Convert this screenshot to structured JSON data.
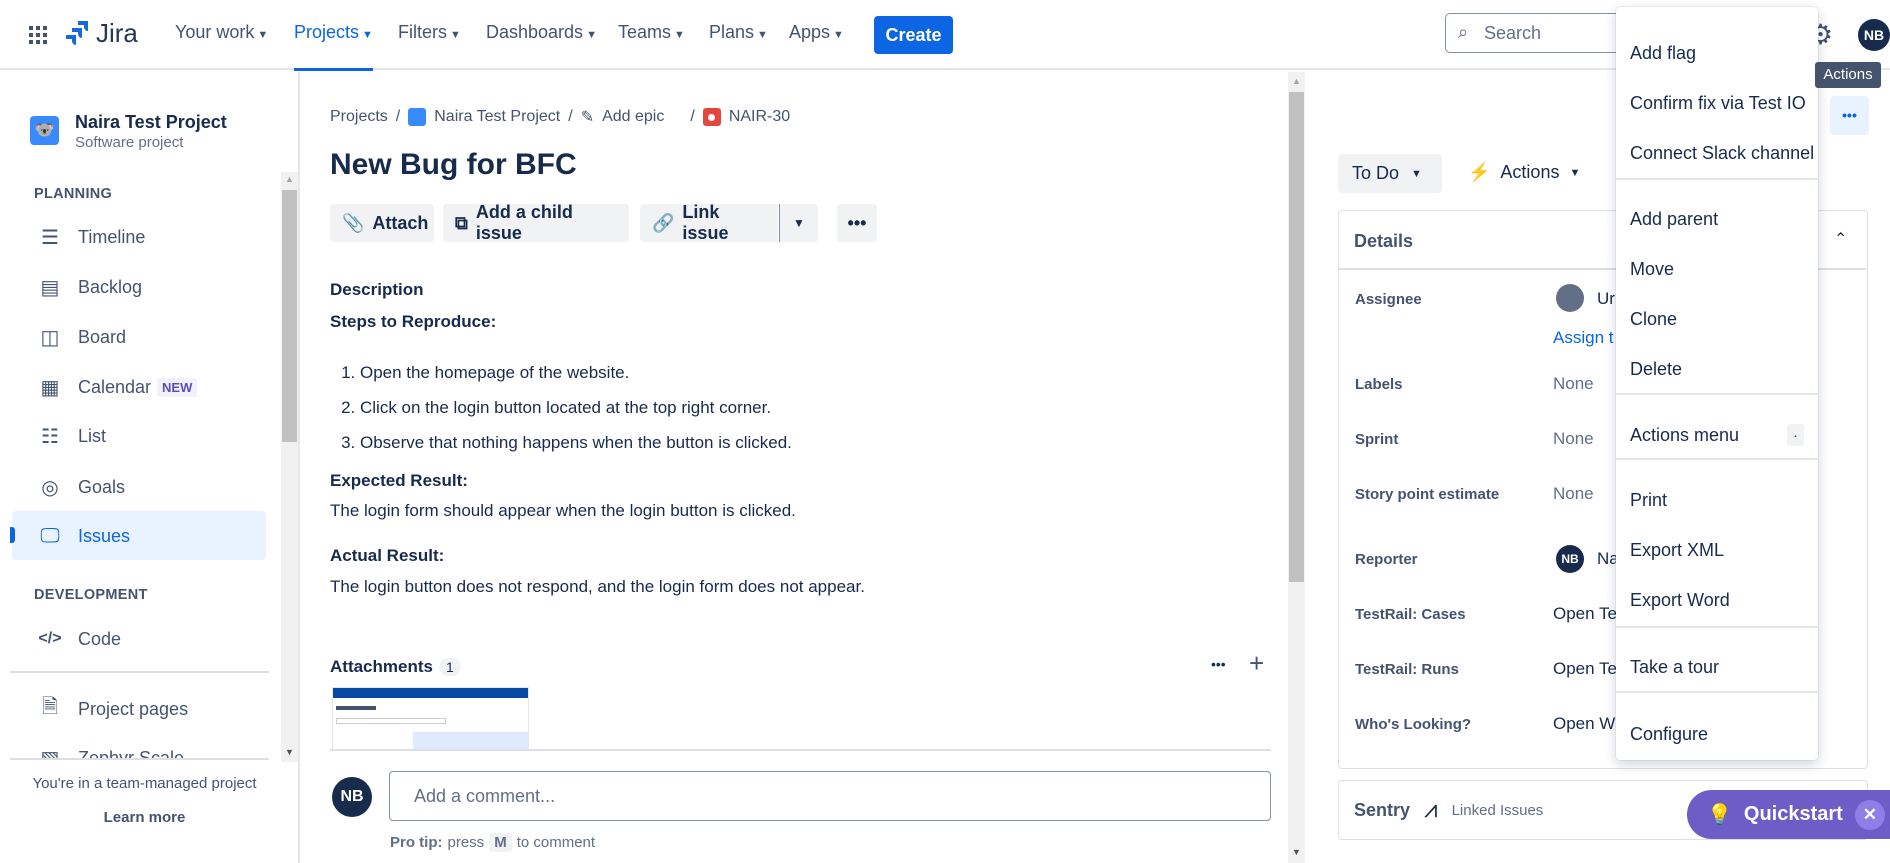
{
  "topbar": {
    "app_name": "Jira",
    "nav": [
      "Your work",
      "Projects",
      "Filters",
      "Dashboards",
      "Teams",
      "Plans",
      "Apps"
    ],
    "create": "Create",
    "search_placeholder": "Search",
    "avatar": "NB",
    "tooltip": "Actions",
    "accent": "#0c66e4"
  },
  "sidebar": {
    "project_name": "Naira Test Project",
    "project_type": "Software project",
    "planning": "PLANNING",
    "items": [
      "Timeline",
      "Backlog",
      "Board",
      "Calendar",
      "List",
      "Goals",
      "Issues"
    ],
    "new_badge": "NEW",
    "development": "DEVELOPMENT",
    "code": "Code",
    "project_pages": "Project pages",
    "zephyr": "Zephyr Scale",
    "footer_text": "You're in a team-managed project",
    "learn_more": "Learn more"
  },
  "issue": {
    "breadcrumb": [
      "Projects",
      "Naira Test Project",
      "Add epic",
      "NAIR-30"
    ],
    "title": "New Bug for BFC",
    "buttons": {
      "attach": "Attach",
      "child": "Add a child issue",
      "link": "Link issue"
    },
    "description_label": "Description",
    "steps_heading": "Steps to Reproduce:",
    "steps": [
      "Open the homepage of the website.",
      "Click on the login button located at the top right corner.",
      "Observe that nothing happens when the button is clicked."
    ],
    "expected_heading": "Expected Result:",
    "expected": "The login form should appear when the login button is clicked.",
    "actual_heading": "Actual Result:",
    "actual": "The login button does not respond, and the login form does not appear.",
    "attachments_label": "Attachments",
    "attachments_count": "1",
    "comment_avatar": "NB",
    "comment_placeholder": "Add a comment...",
    "pro_tip_bold": "Pro tip:",
    "pro_tip_pre": "press",
    "pro_tip_key": "M",
    "pro_tip_post": "to comment"
  },
  "details": {
    "status": "To Do",
    "actions": "Actions",
    "header": "Details",
    "rows": [
      {
        "label": "Assignee",
        "value": "Ur"
      },
      {
        "label": "Labels",
        "value": "None"
      },
      {
        "label": "Sprint",
        "value": "None"
      },
      {
        "label": "Story point estimate",
        "value": "None"
      },
      {
        "label": "Reporter",
        "value": "Na"
      },
      {
        "label": "TestRail: Cases",
        "value": "Open Te"
      },
      {
        "label": "TestRail: Runs",
        "value": "Open Te"
      },
      {
        "label": "Who's Looking?",
        "value": "Open W"
      }
    ],
    "assign_link": "Assign t",
    "reporter_avatar": "NB",
    "sentry": "Sentry",
    "linked_issues": "Linked Issues"
  },
  "menu": {
    "items": [
      "Add flag",
      "Confirm fix via Test IO",
      "Connect Slack channel",
      "Add parent",
      "Move",
      "Clone",
      "Delete",
      "Actions menu",
      "Print",
      "Export XML",
      "Export Word",
      "Take a tour",
      "Configure"
    ],
    "shortcut": "."
  },
  "quickstart": {
    "label": "Quickstart",
    "color": "#6e5dc6"
  }
}
